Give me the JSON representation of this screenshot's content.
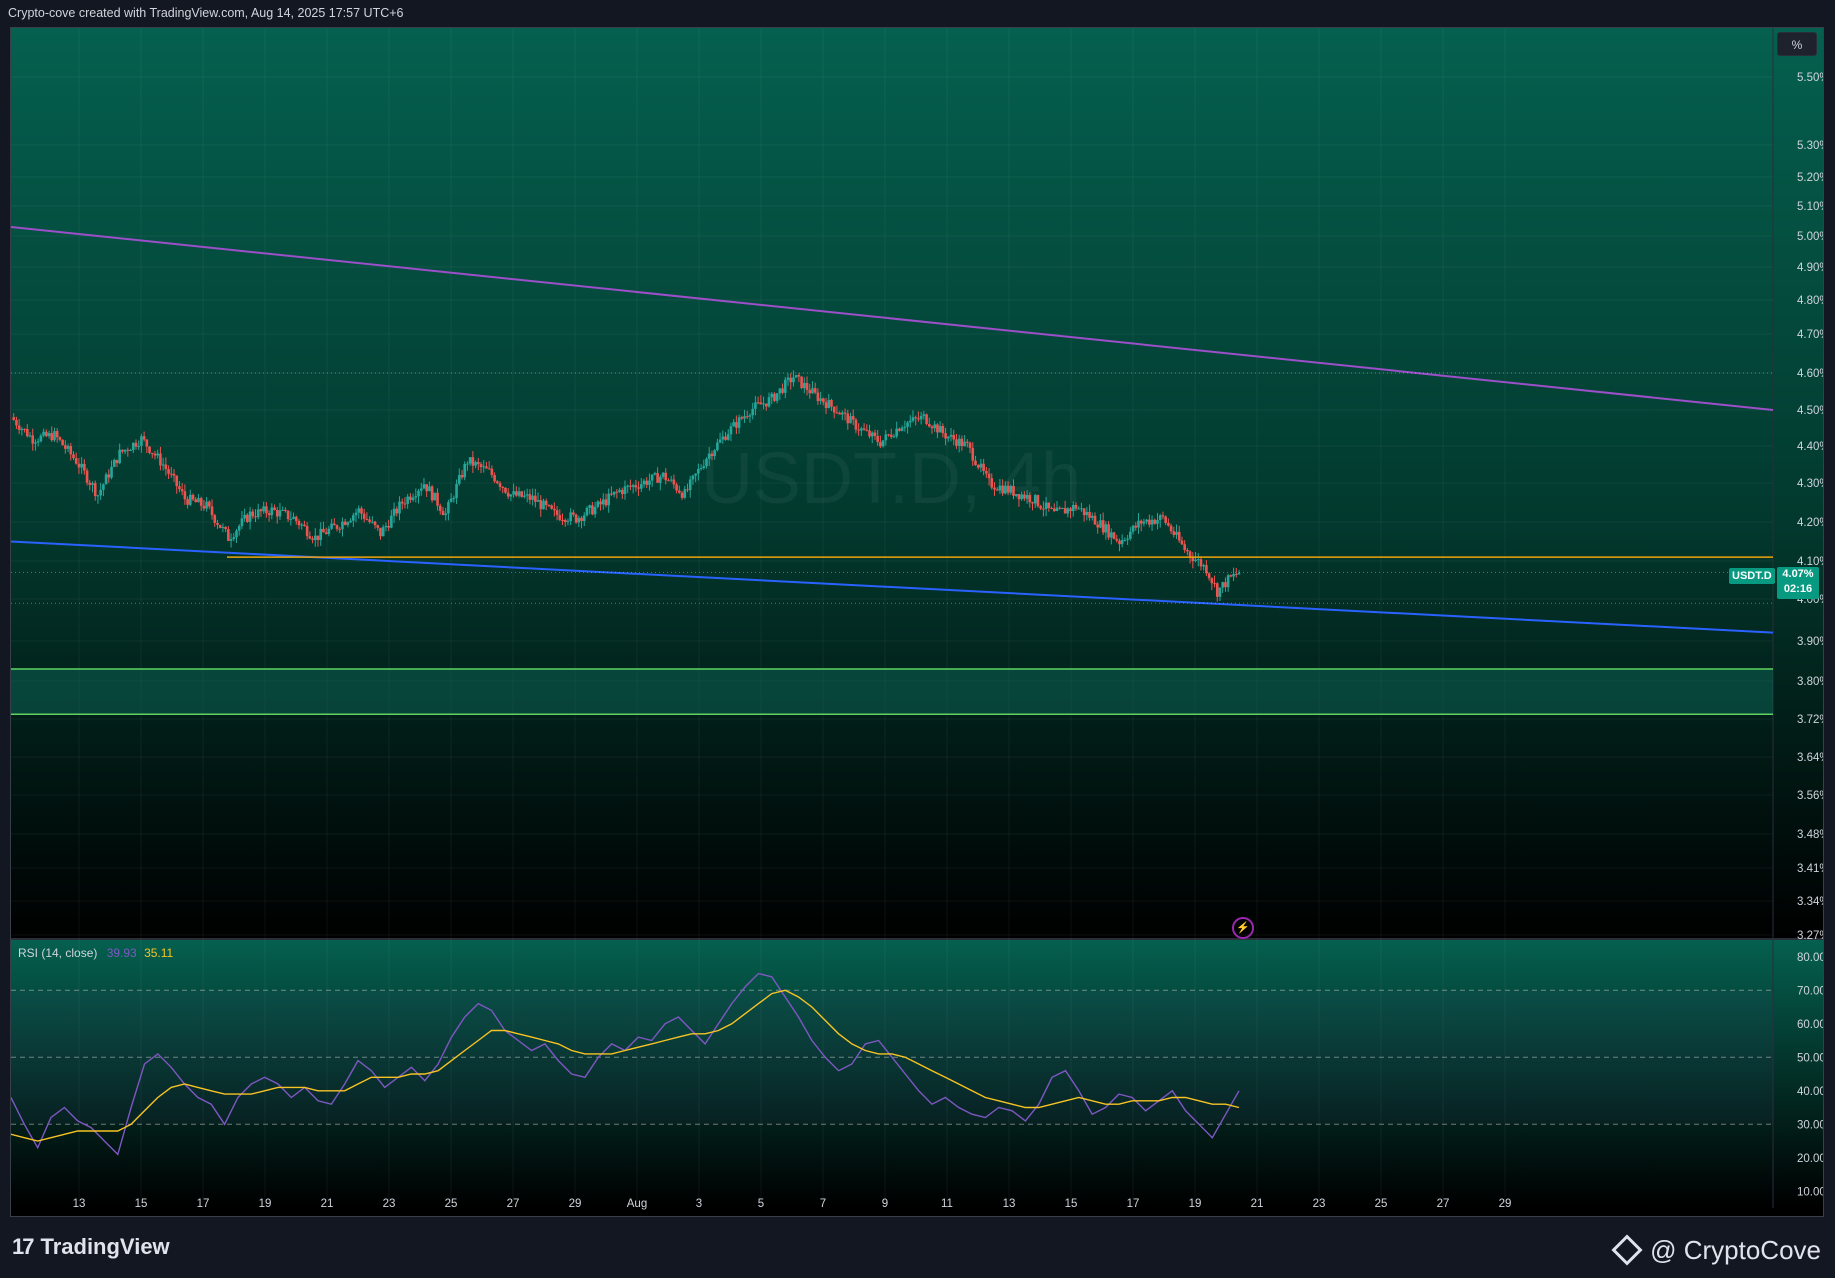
{
  "header": {
    "title": "Crypto-cove created with TradingView.com, Aug 14, 2025 17:57 UTC+6"
  },
  "chart_data": [
    {
      "type": "candlestick",
      "symbol": "USDT.D",
      "timeframe": "4h",
      "watermark": "USDT.D, 4h",
      "scale": "percent",
      "y_axis_ticks": [
        "5.50%",
        "5.30%",
        "5.20%",
        "5.10%",
        "5.00%",
        "4.90%",
        "4.80%",
        "4.70%",
        "4.60%",
        "4.50%",
        "4.40%",
        "4.30%",
        "4.20%",
        "4.10%",
        "4.00%",
        "3.90%",
        "3.80%",
        "3.72%",
        "3.64%",
        "3.56%",
        "3.48%",
        "3.41%",
        "3.34%",
        "3.27%"
      ],
      "x_axis_ticks": [
        "13",
        "15",
        "17",
        "19",
        "21",
        "23",
        "25",
        "27",
        "29",
        "Aug",
        "3",
        "5",
        "7",
        "9",
        "11",
        "13",
        "15",
        "17",
        "19",
        "21",
        "23",
        "25",
        "27",
        "29"
      ],
      "current_price": "4.07%",
      "countdown": "02:16",
      "price_path": [
        [
          0,
          4.48
        ],
        [
          8,
          4.42
        ],
        [
          16,
          4.43
        ],
        [
          24,
          4.36
        ],
        [
          32,
          4.27
        ],
        [
          40,
          4.38
        ],
        [
          48,
          4.42
        ],
        [
          56,
          4.35
        ],
        [
          64,
          4.26
        ],
        [
          72,
          4.24
        ],
        [
          80,
          4.16
        ],
        [
          88,
          4.22
        ],
        [
          96,
          4.23
        ],
        [
          104,
          4.21
        ],
        [
          112,
          4.16
        ],
        [
          120,
          4.19
        ],
        [
          128,
          4.23
        ],
        [
          136,
          4.17
        ],
        [
          144,
          4.25
        ],
        [
          152,
          4.3
        ],
        [
          160,
          4.22
        ],
        [
          168,
          4.36
        ],
        [
          176,
          4.33
        ],
        [
          184,
          4.27
        ],
        [
          192,
          4.26
        ],
        [
          200,
          4.22
        ],
        [
          208,
          4.21
        ],
        [
          216,
          4.24
        ],
        [
          224,
          4.28
        ],
        [
          232,
          4.3
        ],
        [
          240,
          4.32
        ],
        [
          248,
          4.27
        ],
        [
          256,
          4.37
        ],
        [
          264,
          4.44
        ],
        [
          272,
          4.5
        ],
        [
          280,
          4.53
        ],
        [
          288,
          4.59
        ],
        [
          296,
          4.54
        ],
        [
          304,
          4.5
        ],
        [
          312,
          4.45
        ],
        [
          320,
          4.41
        ],
        [
          328,
          4.46
        ],
        [
          336,
          4.48
        ],
        [
          344,
          4.43
        ],
        [
          352,
          4.4
        ],
        [
          360,
          4.3
        ],
        [
          368,
          4.28
        ],
        [
          376,
          4.26
        ],
        [
          384,
          4.22
        ],
        [
          392,
          4.24
        ],
        [
          400,
          4.2
        ],
        [
          408,
          4.15
        ],
        [
          416,
          4.2
        ],
        [
          424,
          4.21
        ],
        [
          432,
          4.13
        ],
        [
          440,
          4.08
        ],
        [
          444,
          4.02
        ],
        [
          448,
          4.05
        ],
        [
          452,
          4.07
        ]
      ],
      "lines": [
        {
          "name": "upper-trendline",
          "color": "#9c4fc9",
          "from": [
            "2025-07-12",
            5.03
          ],
          "to": [
            "2025-08-29",
            4.5
          ]
        },
        {
          "name": "lower-trendline",
          "color": "#2962ff",
          "from": [
            "2025-07-12",
            4.15
          ],
          "to": [
            "2025-08-29",
            3.92
          ]
        },
        {
          "name": "horizontal-level",
          "color": "#f0a30a",
          "value": 4.11
        },
        {
          "name": "support-zone-top",
          "color": "#5fd35f",
          "value": 3.83
        },
        {
          "name": "support-zone-bottom",
          "color": "#5fd35f",
          "value": 3.73
        }
      ]
    },
    {
      "type": "line",
      "name": "RSI (14, close)",
      "values_text": [
        "39.93",
        "35.11"
      ],
      "y_axis_ticks": [
        "80.00",
        "70.00",
        "60.00",
        "50.00",
        "40.00",
        "30.00",
        "20.00",
        "10.00"
      ],
      "bands": [
        70,
        50,
        30
      ],
      "series": [
        {
          "name": "RSI",
          "color": "#7e57c2",
          "values": [
            38,
            30,
            23,
            32,
            35,
            31,
            29,
            25,
            21,
            35,
            48,
            51,
            47,
            42,
            38,
            36,
            30,
            38,
            42,
            44,
            42,
            38,
            41,
            37,
            36,
            42,
            49,
            46,
            41,
            44,
            47,
            43,
            48,
            56,
            62,
            66,
            64,
            58,
            55,
            52,
            54,
            49,
            45,
            44,
            50,
            54,
            52,
            56,
            55,
            60,
            62,
            58,
            54,
            60,
            66,
            71,
            75,
            74,
            68,
            62,
            55,
            50,
            46,
            48,
            54,
            55,
            50,
            45,
            40,
            36,
            38,
            35,
            33,
            32,
            35,
            34,
            31,
            36,
            44,
            46,
            40,
            33,
            35,
            39,
            38,
            34,
            37,
            40,
            34,
            30,
            26,
            33,
            40
          ]
        },
        {
          "name": "RSI-based MA",
          "color": "#f7c325",
          "values": [
            27,
            26,
            25,
            26,
            27,
            28,
            28,
            28,
            28,
            30,
            34,
            38,
            41,
            42,
            41,
            40,
            39,
            39,
            39,
            40,
            41,
            41,
            41,
            40,
            40,
            40,
            42,
            44,
            44,
            44,
            45,
            45,
            46,
            49,
            52,
            55,
            58,
            58,
            57,
            56,
            55,
            54,
            52,
            51,
            51,
            51,
            52,
            53,
            54,
            55,
            56,
            57,
            57,
            58,
            60,
            63,
            66,
            69,
            70,
            68,
            65,
            61,
            57,
            54,
            52,
            51,
            51,
            50,
            48,
            46,
            44,
            42,
            40,
            38,
            37,
            36,
            35,
            35,
            36,
            37,
            38,
            37,
            36,
            36,
            37,
            37,
            37,
            38,
            38,
            37,
            36,
            36,
            35
          ]
        }
      ]
    }
  ],
  "footer": {
    "brand": "TradingView",
    "watermark_brand": "@ CryptoCove"
  },
  "ui": {
    "percent_button": "%",
    "price_tag_time": "02:16"
  },
  "colors": {
    "bg_top": "#05604f",
    "bg_bottom": "#000000",
    "up": "#26a69a",
    "down": "#ef5350"
  },
  "icons": {
    "alert": "lightning-icon"
  }
}
